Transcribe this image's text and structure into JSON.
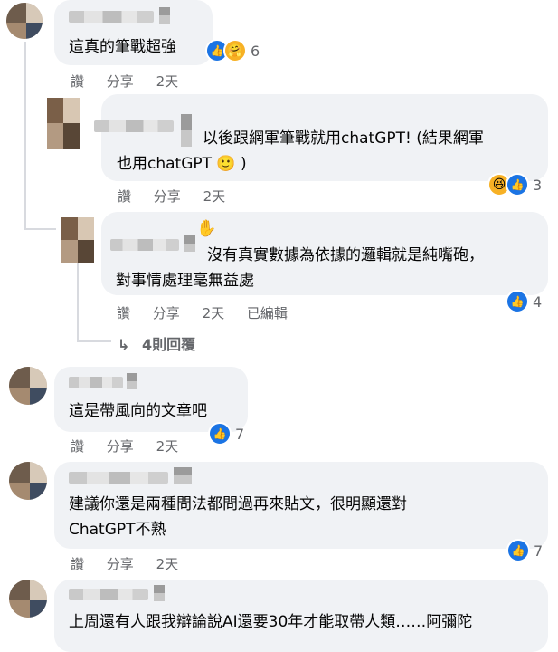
{
  "comments": [
    {
      "text_lines": [
        "這真的筆戰超強"
      ],
      "reaction_count": "6",
      "actions": {
        "like": "讚",
        "share": "分享",
        "time": "2天"
      }
    },
    {
      "text_lines": [
        "以後跟網軍筆戰就用chatGPT! (結果網軍",
        "也用chatGPT 🙂 )"
      ],
      "reaction_count": "3",
      "actions": {
        "like": "讚",
        "share": "分享",
        "time": "2天"
      }
    },
    {
      "text_lines": [
        "沒有真實數據為依據的邏輯就是純嘴砲，",
        "對事情處理毫無益處"
      ],
      "reaction_count": "4",
      "actions": {
        "like": "讚",
        "share": "分享",
        "time": "2天",
        "edited": "已編輯"
      }
    },
    {
      "text_lines": [
        "這是帶風向的文章吧"
      ],
      "reaction_count": "7",
      "actions": {
        "like": "讚",
        "share": "分享",
        "time": "2天"
      }
    },
    {
      "text_lines": [
        "建議你還是兩種問法都問過再來貼文，很明顯還對",
        "ChatGPT不熟"
      ],
      "reaction_count": "7",
      "actions": {
        "like": "讚",
        "share": "分享",
        "time": "2天"
      }
    },
    {
      "text_lines": [
        "上周還有人跟我辯論說AI還要30年才能取帶人類……阿彌陀"
      ]
    }
  ],
  "replies_link": "4則回覆",
  "reply_arrow_icon": "↳",
  "colors": {
    "like_blue": "#1b74e4",
    "bubble_bg": "#f0f2f5",
    "meta_gray": "#65676b"
  }
}
